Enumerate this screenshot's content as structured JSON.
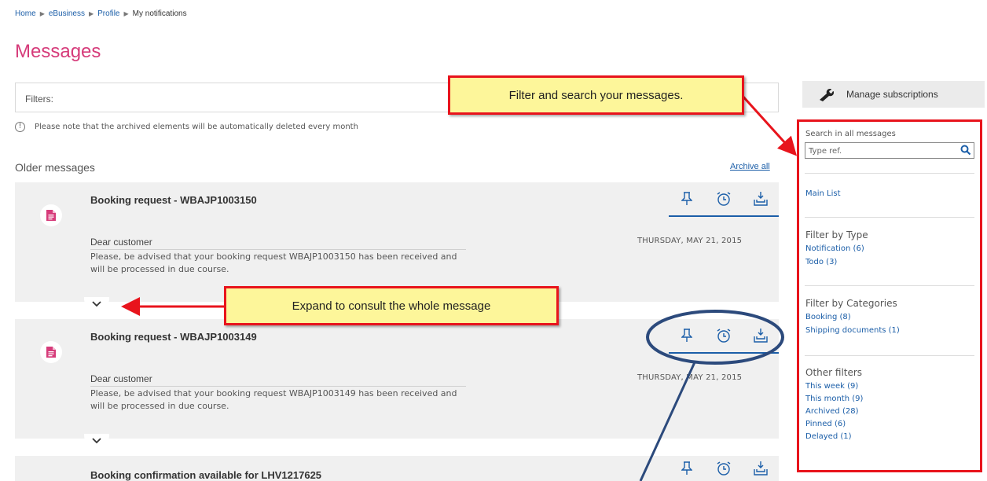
{
  "breadcrumb": [
    "Home",
    "eBusiness",
    "Profile",
    "My notifications"
  ],
  "page_title": "Messages",
  "filters_label": "Filters:",
  "archive_note": "Please note that the archived elements will be automatically deleted every month",
  "section_title": "Older messages",
  "archive_all": "Archive all",
  "messages": [
    {
      "subject": "Booking request - WBAJP1003150",
      "greeting": "Dear customer",
      "body": "Please, be advised that your booking request WBAJP1003150 has been received and will be processed in due course.",
      "date": "THURSDAY, MAY 21, 2015"
    },
    {
      "subject": "Booking request - WBAJP1003149",
      "greeting": "Dear customer",
      "body": "Please, be advised that your booking request WBAJP1003149 has been received and will be processed in due course.",
      "date": "THURSDAY, MAY 21, 2015"
    },
    {
      "subject": "Booking confirmation available for LHV1217625"
    }
  ],
  "sidebar": {
    "manage_subscriptions": "Manage subscriptions",
    "search_label": "Search in all messages",
    "search_placeholder": "Type ref.",
    "main_list": "Main List",
    "filter_type_title": "Filter by Type",
    "filter_type": [
      "Notification (6)",
      "Todo (3)"
    ],
    "filter_categories_title": "Filter by Categories",
    "filter_categories": [
      "Booking (8)",
      "Shipping documents (1)"
    ],
    "other_filters_title": "Other filters",
    "other_filters": [
      "This week (9)",
      "This month (9)",
      "Archived (28)",
      "Pinned (6)",
      "Delayed (1)"
    ]
  },
  "annotations": {
    "filter_callout": "Filter and search your messages.",
    "expand_callout": "Expand to consult the whole message"
  },
  "colors": {
    "accent_pink": "#d63b7a",
    "link_blue": "#1b5ea8",
    "callout_border": "#e8141c",
    "callout_fill": "#fdf69a",
    "circle_highlight": "#2c4a7c"
  },
  "icons": {
    "pin": "pin-icon",
    "delay": "alarm-clock-icon",
    "archive": "archive-tray-icon",
    "message_type": "document-icon",
    "expand": "chevron-down-icon",
    "manage": "wrench-icon",
    "search": "search-icon"
  }
}
